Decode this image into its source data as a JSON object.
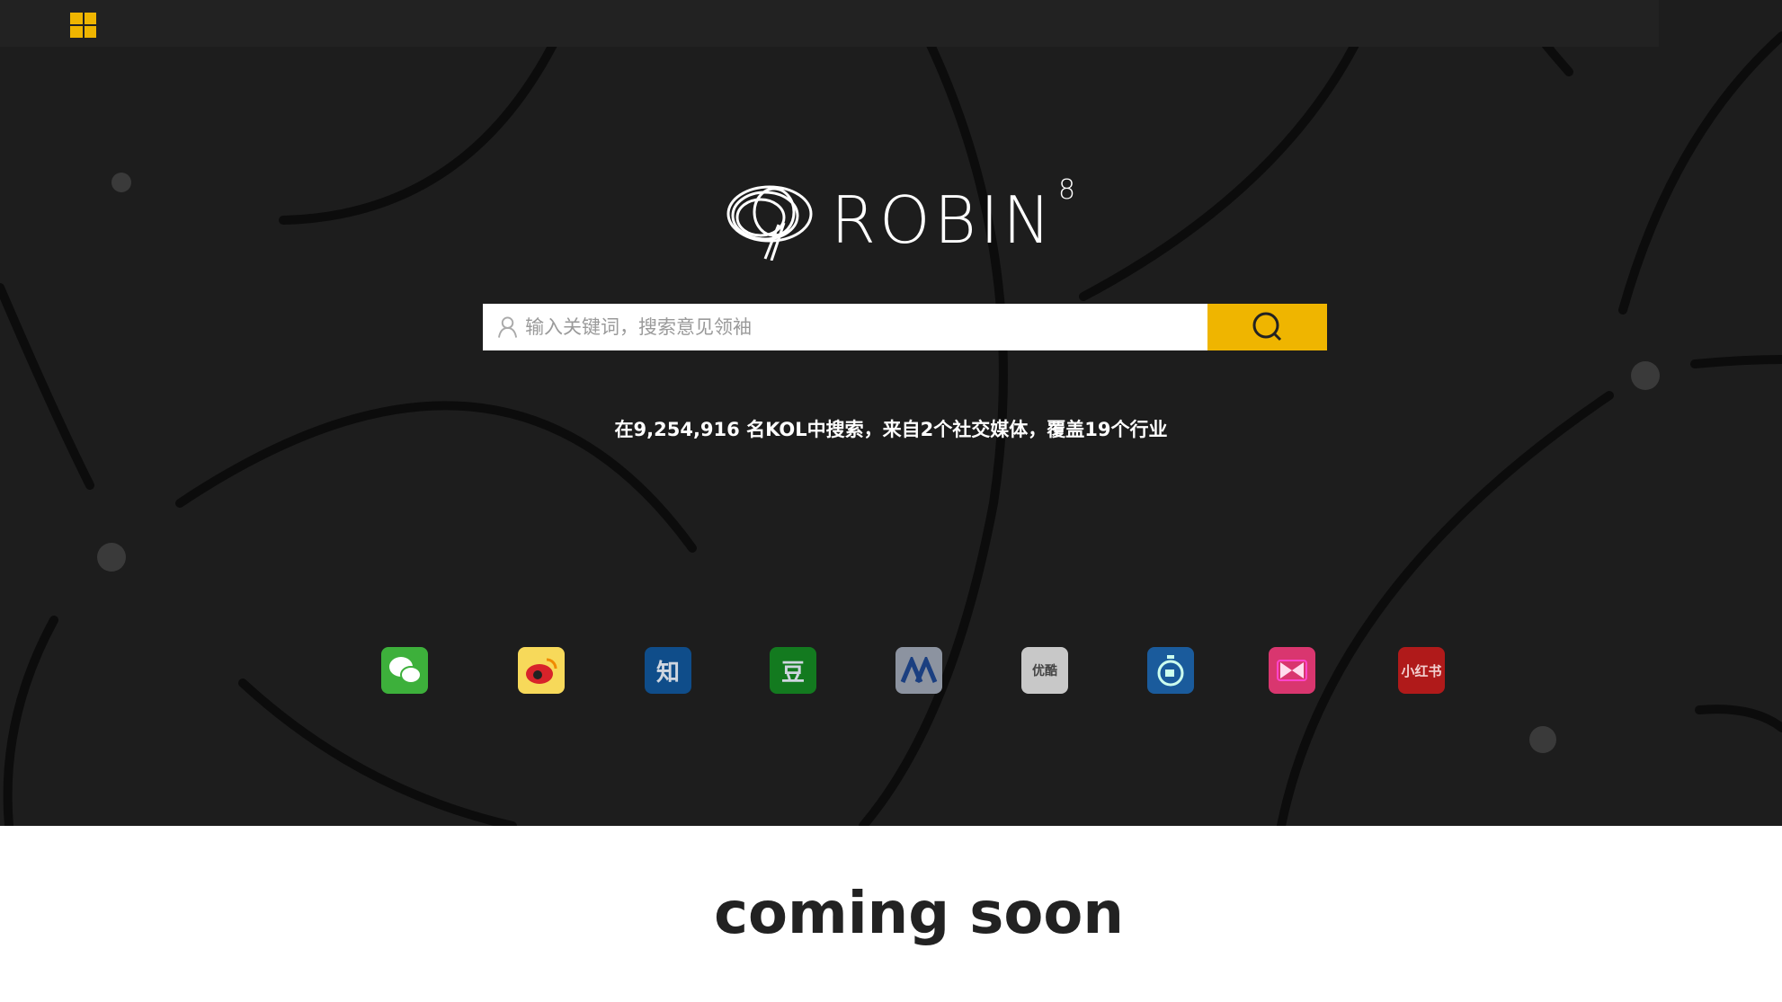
{
  "header": {
    "menu_icon": "grid-icon"
  },
  "logo": {
    "word": "ROBIN",
    "sup": "8"
  },
  "search": {
    "placeholder": "输入关键词，搜索意见领袖",
    "value": "",
    "button_icon": "search-icon"
  },
  "stats_text": "在9,254,916 名KOL中搜索，来自2个社交媒体，覆盖19个行业",
  "platforms": [
    {
      "name": "wechat",
      "label": "",
      "color": "#3db03b"
    },
    {
      "name": "weibo",
      "label": "",
      "color": "#f7d95a"
    },
    {
      "name": "zhihu",
      "label": "知",
      "color": "#0f4d8a"
    },
    {
      "name": "douban",
      "label": "豆",
      "color": "#137a1f"
    },
    {
      "name": "tianya",
      "label": "",
      "color": "#8c93a0"
    },
    {
      "name": "youku",
      "label": "优酷",
      "color": "#c8c8c8"
    },
    {
      "name": "miaopai",
      "label": "",
      "color": "#1a5b9c"
    },
    {
      "name": "meipai",
      "label": "",
      "color": "#d9366f"
    },
    {
      "name": "xiaohongshu",
      "label": "小红书",
      "color": "#b01a1a"
    }
  ],
  "footer": {
    "coming_soon": "coming soon"
  }
}
